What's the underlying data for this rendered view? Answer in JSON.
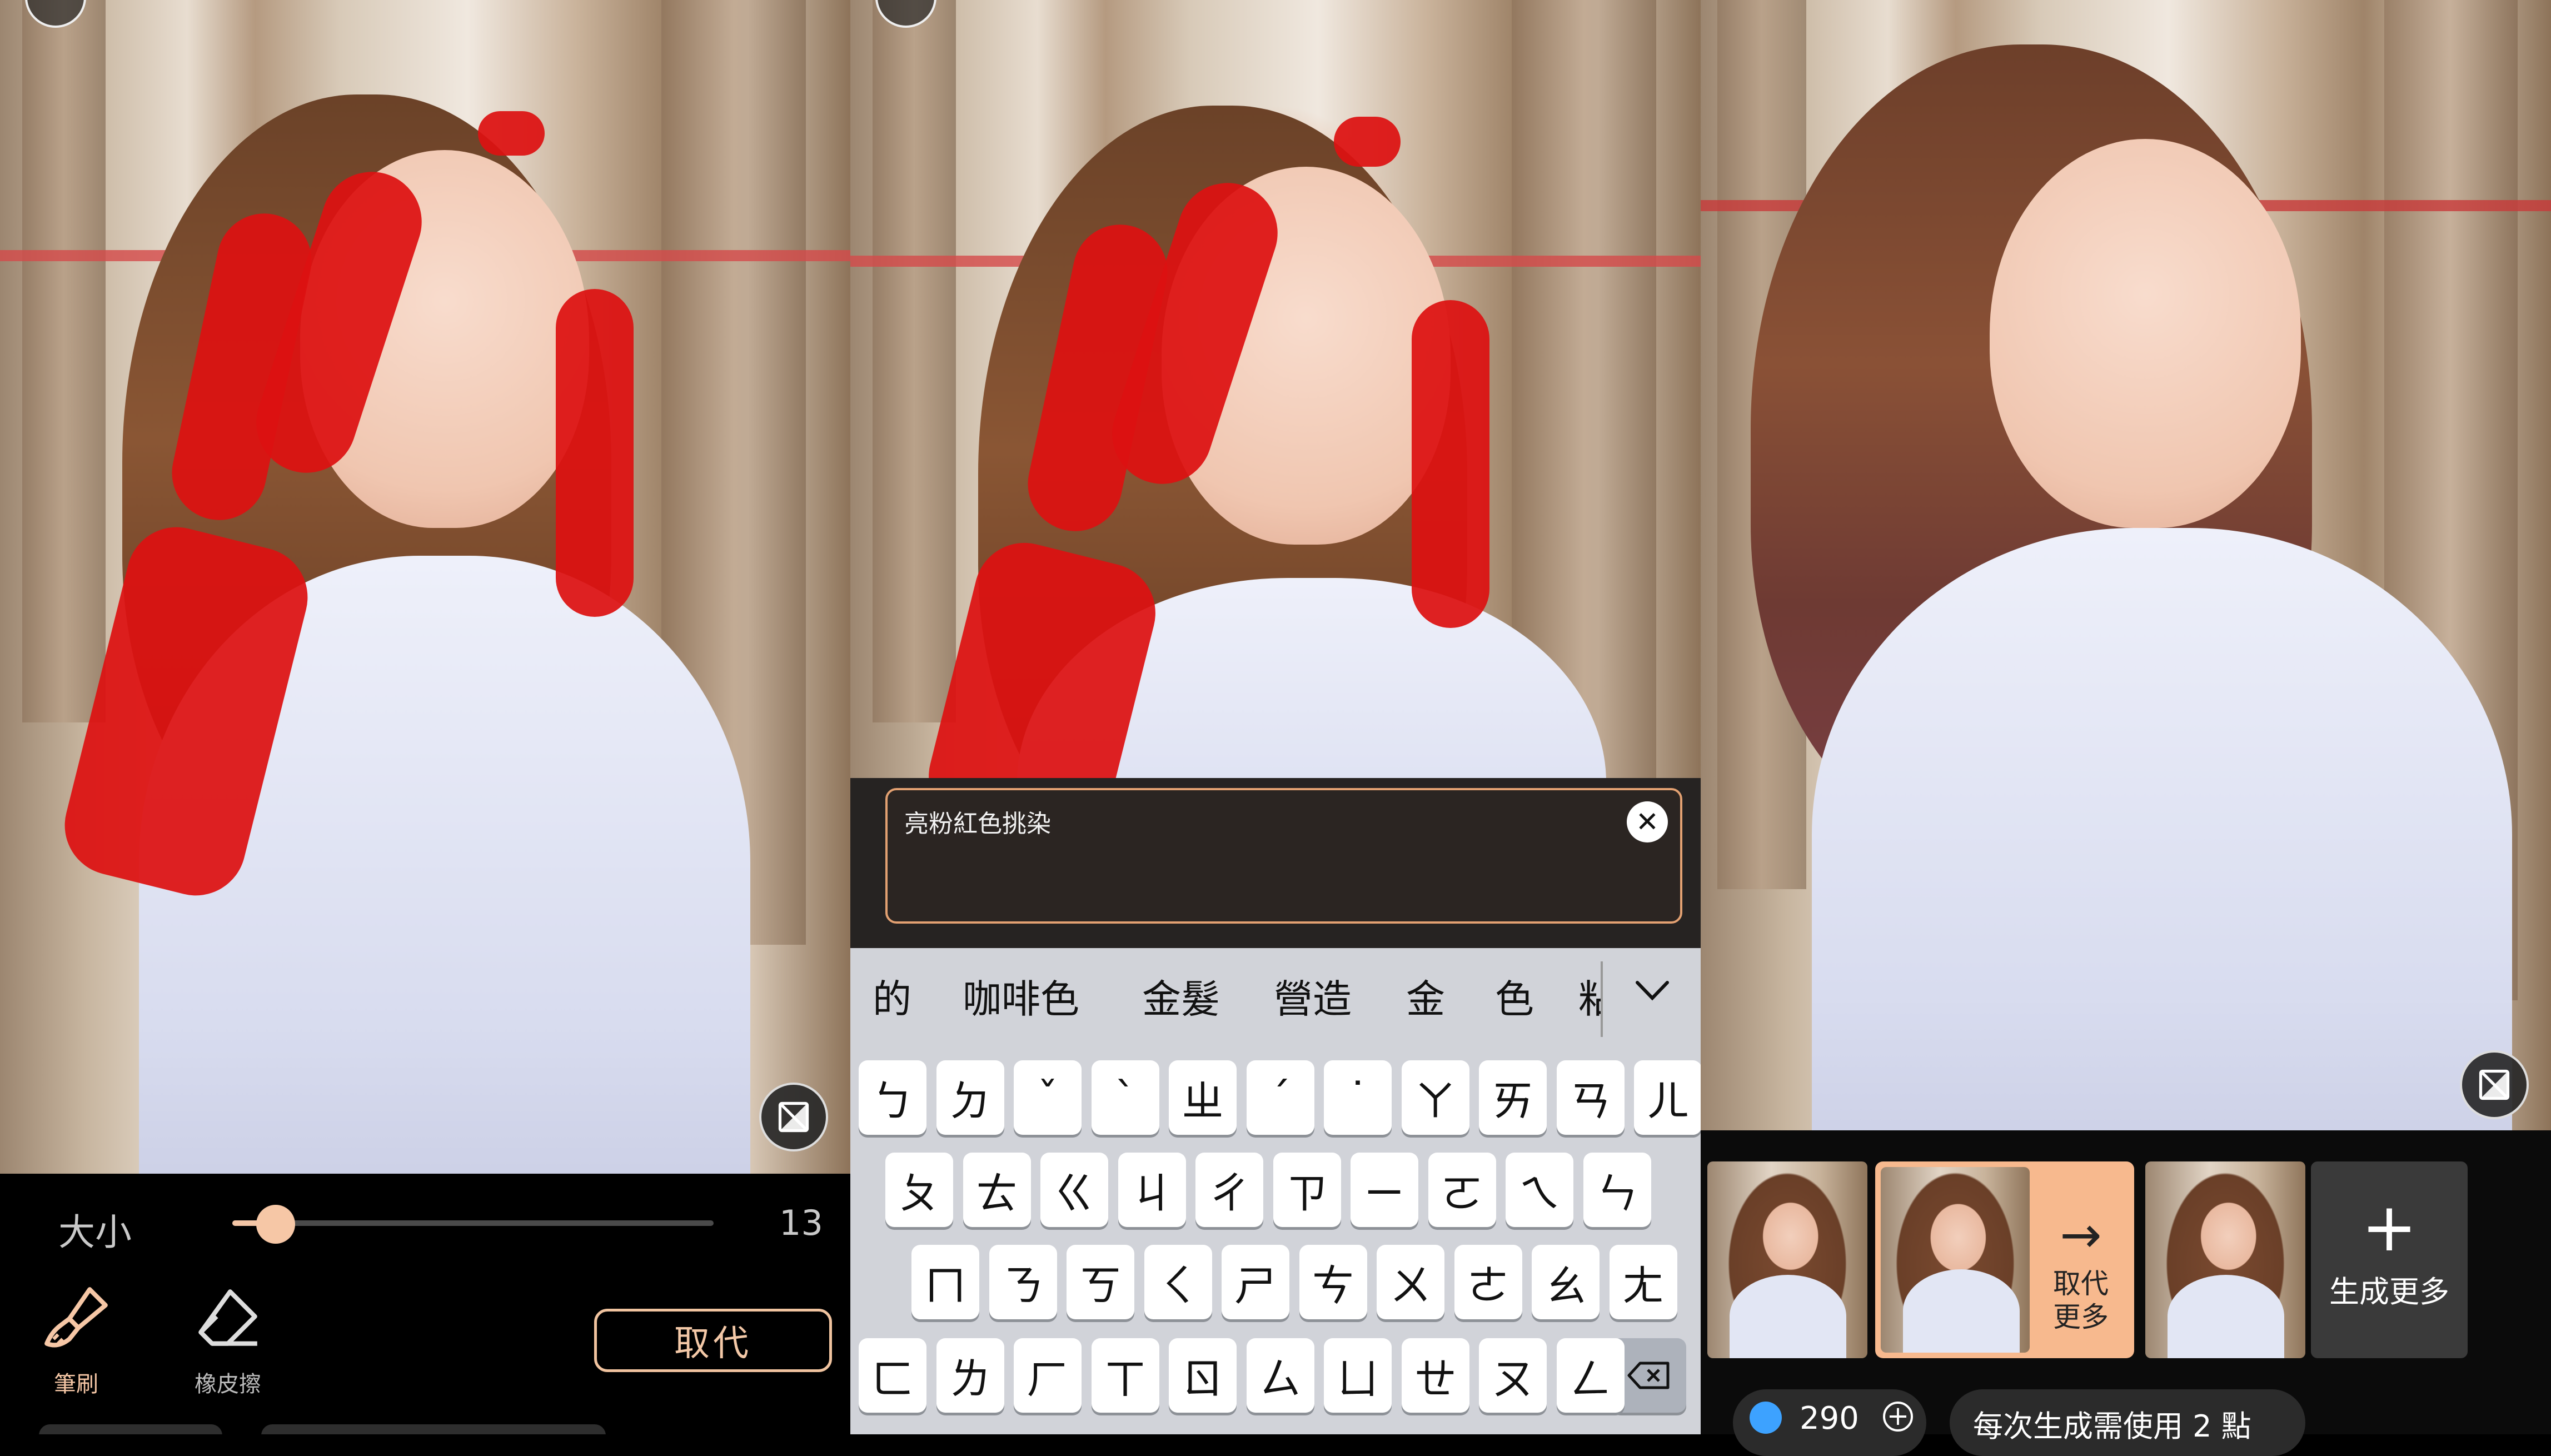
{
  "panel1": {
    "size_label": "大小",
    "size_value": "13",
    "size_fraction": 0.09,
    "tools": [
      {
        "label": "筆刷",
        "icon": "brush-icon",
        "active": true
      },
      {
        "label": "橡皮擦",
        "icon": "eraser-icon",
        "active": false
      }
    ],
    "replace_button": "取代"
  },
  "panel2": {
    "prompt_text": "亮粉紅色挑染",
    "suggestions": [
      "的",
      "咖啡色",
      "金髮",
      "營造",
      "金",
      "色",
      "粘"
    ],
    "keyboard_rows": [
      [
        "ㄅ",
        "ㄉ",
        "ˇ",
        "ˋ",
        "ㄓ",
        "ˊ",
        "˙",
        "ㄚ",
        "ㄞ",
        "ㄢ",
        "ㄦ"
      ],
      [
        "ㄆ",
        "ㄊ",
        "ㄍ",
        "ㄐ",
        "ㄔ",
        "ㄗ",
        "ㄧ",
        "ㄛ",
        "ㄟ",
        "ㄣ"
      ],
      [
        "ㄇ",
        "ㄋ",
        "ㄎ",
        "ㄑ",
        "ㄕ",
        "ㄘ",
        "ㄨ",
        "ㄜ",
        "ㄠ",
        "ㄤ"
      ],
      [
        "ㄈ",
        "ㄌ",
        "ㄏ",
        "ㄒ",
        "ㄖ",
        "ㄙ",
        "ㄩ",
        "ㄝ",
        "ㄡ",
        "ㄥ"
      ]
    ]
  },
  "panel3": {
    "selected_card_label": "取代更多",
    "selected_card_line1": "取代",
    "selected_card_line2": "更多",
    "generate_more_label": "生成更多",
    "points": "290",
    "cost_info": "每次生成需使用 2 點"
  },
  "colors": {
    "accent": "#f6c7a6",
    "paint": "#dd1111",
    "prompt_border": "#e3a172"
  },
  "icons": [
    "info-icon",
    "brush-icon",
    "eraser-icon",
    "compare-icon",
    "close-icon",
    "chevron-down-icon",
    "backspace-icon",
    "arrow-right-icon",
    "plus-icon",
    "gem-icon",
    "add-circle-icon"
  ]
}
